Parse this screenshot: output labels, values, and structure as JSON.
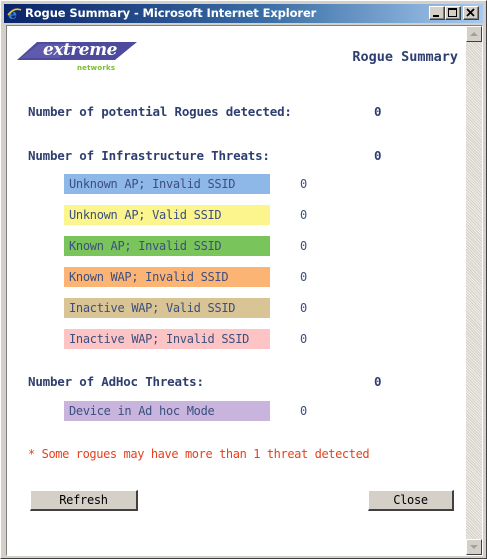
{
  "window": {
    "title": "Rogue Summary - Microsoft Internet Explorer"
  },
  "logo": {
    "word": "extreme",
    "sub": "networks"
  },
  "page": {
    "title": "Rogue Summary"
  },
  "summary": {
    "potential_label": "Number of potential Rogues detected:",
    "potential_value": "0",
    "infrastructure_label": "Number of Infrastructure Threats:",
    "infrastructure_value": "0",
    "adhoc_label": "Number of AdHoc Threats:",
    "adhoc_value": "0"
  },
  "infrastructure_threats": [
    {
      "label": "Unknown AP; Invalid SSID",
      "value": "0",
      "color": "#8eb8e8"
    },
    {
      "label": "Unknown AP; Valid SSID",
      "value": "0",
      "color": "#fcf48c"
    },
    {
      "label": "Known AP; Invalid SSID",
      "value": "0",
      "color": "#7ac45c"
    },
    {
      "label": "Known WAP; Invalid SSID",
      "value": "0",
      "color": "#fcb474"
    },
    {
      "label": "Inactive WAP; Valid SSID",
      "value": "0",
      "color": "#d8c494"
    },
    {
      "label": "Inactive WAP; Invalid SSID",
      "value": "0",
      "color": "#fcc4c4"
    }
  ],
  "adhoc_threats": [
    {
      "label": "Device in Ad hoc Mode",
      "value": "0",
      "color": "#c8b4dc"
    }
  ],
  "note": "* Some rogues may have more than 1 threat detected",
  "buttons": {
    "refresh": "Refresh",
    "close": "Close"
  },
  "colors": {
    "heading": "#2e3f6f",
    "note": "#e8401c",
    "logo_green": "#7bbd2a",
    "logo_blue": "#4e4a9c"
  },
  "icons": {
    "app": "ie-icon",
    "minimize": "minimize-icon",
    "maximize": "maximize-icon",
    "close": "close-icon"
  }
}
